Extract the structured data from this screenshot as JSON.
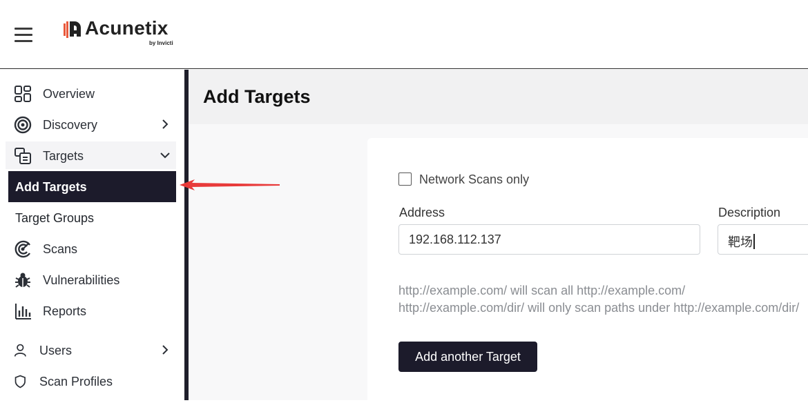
{
  "brand": {
    "name": "Acunetix",
    "sub": "by Invicti",
    "accent_color": "#e8583a"
  },
  "sidebar": {
    "items": [
      {
        "label": "Overview",
        "icon": "overview-grid-icon"
      },
      {
        "label": "Discovery",
        "icon": "target-icon"
      },
      {
        "label": "Targets",
        "icon": "targets-icon"
      },
      {
        "label": "Add Targets"
      },
      {
        "label": "Target Groups"
      },
      {
        "label": "Scans",
        "icon": "scans-icon"
      },
      {
        "label": "Vulnerabilities",
        "icon": "bug-icon"
      },
      {
        "label": "Reports",
        "icon": "reports-chart-icon"
      },
      {
        "label": "Users",
        "icon": "user-icon"
      },
      {
        "label": "Scan Profiles",
        "icon": "shield-icon"
      }
    ]
  },
  "main": {
    "title": "Add Targets",
    "network_scans_label": "Network Scans only",
    "address_label": "Address",
    "address_value": "192.168.112.137",
    "description_label": "Description",
    "description_value": "靶场",
    "help_line1": "http://example.com/ will scan all http://example.com/",
    "help_line2": "http://example.com/dir/ will only scan paths under http://example.com/dir/",
    "add_another_button": "Add another Target"
  },
  "colors": {
    "active_bg": "#1c1b2b",
    "annotation_arrow": "#e83a3a"
  }
}
